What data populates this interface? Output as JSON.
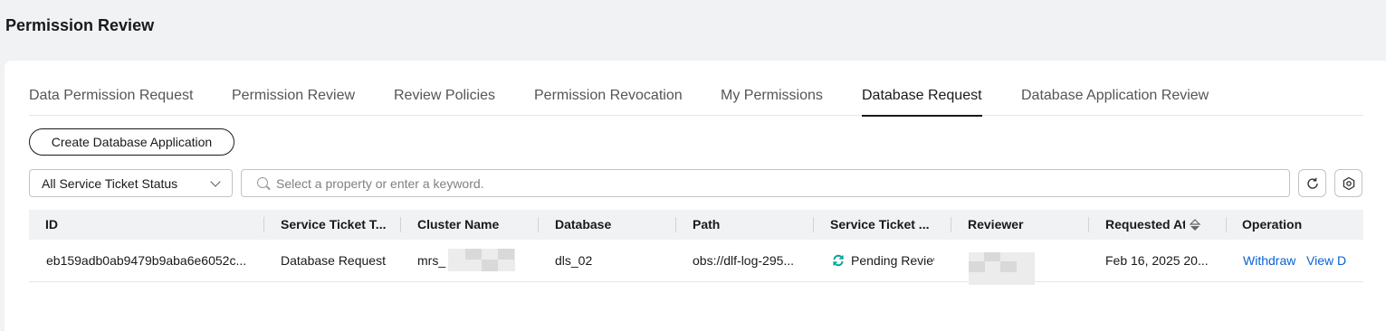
{
  "page": {
    "title": "Permission Review"
  },
  "tabs": [
    {
      "label": "Data Permission Request"
    },
    {
      "label": "Permission Review"
    },
    {
      "label": "Review Policies"
    },
    {
      "label": "Permission Revocation"
    },
    {
      "label": "My Permissions"
    },
    {
      "label": "Database Request",
      "active": true
    },
    {
      "label": "Database Application Review"
    }
  ],
  "toolbar": {
    "create_label": "Create Database Application",
    "status_filter": "All Service Ticket Status",
    "search_placeholder": "Select a property or enter a keyword.",
    "refresh_icon": "refresh-icon",
    "settings_icon": "gear-icon"
  },
  "table": {
    "headers": [
      "ID",
      "Service Ticket T...",
      "Cluster Name",
      "Database",
      "Path",
      "Service Ticket ...",
      "Reviewer",
      "Requested At",
      "Operation"
    ],
    "rows": [
      {
        "id": "eb159adb0ab9479b9aba6e6052c...",
        "ticket_type": "Database Request",
        "cluster": "mrs_",
        "database": "dls_02",
        "path": "obs://dlf-log-295...",
        "status": "Pending Review",
        "reviewer": "",
        "requested_at": "Feb 16, 2025 20...",
        "actions": [
          "Withdraw",
          "View D"
        ]
      }
    ]
  },
  "colors": {
    "accent": "#0a62d1",
    "status_icon": "#00a59a"
  }
}
